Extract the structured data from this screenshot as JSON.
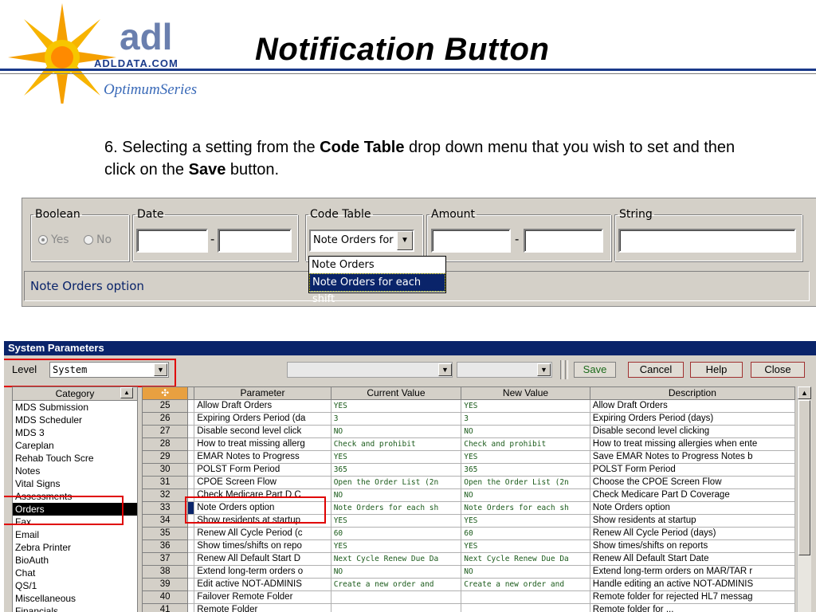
{
  "header": {
    "logo_text": "adl",
    "logo_domain": "ADLDATA.COM",
    "logo_series": "OptimumSeries",
    "title": "Notification Button",
    "accent_color": "#1a3a8a"
  },
  "instruction": {
    "prefix": "6. Selecting a setting from the ",
    "bold1": "Code Table",
    "middle": " drop down menu that you wish to set and then click on the ",
    "bold2": "Save",
    "suffix": "  button."
  },
  "settings_panel": {
    "boolean": {
      "legend": "Boolean",
      "yes_label": "Yes",
      "no_label": "No",
      "selected": "Yes"
    },
    "date": {
      "legend": "Date",
      "separator": "-"
    },
    "code_table": {
      "legend": "Code Table",
      "selected_value": "Note Orders for each shift",
      "options": [
        "Note Orders",
        "Note Orders for each shift"
      ],
      "highlighted_option": "Note Orders for each shift"
    },
    "amount": {
      "legend": "Amount",
      "separator": "-"
    },
    "string": {
      "legend": "String"
    },
    "status_text": "Note Orders option"
  },
  "window": {
    "title": "System Parameters",
    "level_label": "Level",
    "level_value": "System",
    "buttons": {
      "save": "Save",
      "cancel": "Cancel",
      "help": "Help",
      "close": "Close"
    },
    "category_header": "Category",
    "categories": [
      "MDS Submission",
      "MDS Scheduler",
      "MDS 3",
      "Careplan",
      "Rehab Touch Scre",
      "Notes",
      "Vital Signs",
      "Assessments",
      "Orders",
      "Fax",
      "Email",
      "Zebra Printer",
      "BioAuth",
      "Chat",
      "QS/1",
      "Miscellaneous",
      "Financials"
    ],
    "selected_category": "Orders",
    "grid": {
      "columns": [
        "Parameter",
        "Current Value",
        "New Value",
        "Description"
      ],
      "rows": [
        {
          "num": "25",
          "param": "Allow Draft Orders",
          "cur": "YES",
          "new": "YES",
          "desc": "Allow Draft Orders"
        },
        {
          "num": "26",
          "param": "Expiring Orders Period (da",
          "cur": "3",
          "new": "3",
          "desc": "Expiring Orders Period (days)"
        },
        {
          "num": "27",
          "param": "Disable second level click",
          "cur": "NO",
          "new": "NO",
          "desc": "Disable second level clicking"
        },
        {
          "num": "28",
          "param": "How to treat missing allerg",
          "cur": "Check and prohibit",
          "new": "Check and prohibit",
          "desc": "How to treat missing allergies when ente"
        },
        {
          "num": "29",
          "param": "EMAR Notes to Progress",
          "cur": "YES",
          "new": "YES",
          "desc": "Save EMAR Notes to Progress Notes b"
        },
        {
          "num": "30",
          "param": "POLST Form Period",
          "cur": "365",
          "new": "365",
          "desc": "POLST Form Period"
        },
        {
          "num": "31",
          "param": "CPOE Screen Flow",
          "cur": "Open the Order List (2n",
          "new": "Open the Order List (2n",
          "desc": "Choose the CPOE Screen Flow"
        },
        {
          "num": "32",
          "param": "Check Medicare Part D C",
          "cur": "NO",
          "new": "NO",
          "desc": "Check Medicare Part D Coverage"
        },
        {
          "num": "33",
          "param": "Note Orders option",
          "cur": "Note Orders for each sh",
          "new": "Note Orders for each sh",
          "desc": "Note Orders option"
        },
        {
          "num": "34",
          "param": "Show residents at startup",
          "cur": "YES",
          "new": "YES",
          "desc": "Show residents at startup"
        },
        {
          "num": "35",
          "param": "Renew All Cycle Period (c",
          "cur": "60",
          "new": "60",
          "desc": "Renew All Cycle Period (days)"
        },
        {
          "num": "36",
          "param": "Show times/shifts on repo",
          "cur": "YES",
          "new": "YES",
          "desc": "Show times/shifts on reports"
        },
        {
          "num": "37",
          "param": "Renew All Default Start D",
          "cur": "Next Cycle Renew Due Da",
          "new": "Next Cycle Renew Due Da",
          "desc": "Renew All Default Start Date"
        },
        {
          "num": "38",
          "param": "Extend long-term orders o",
          "cur": "NO",
          "new": "NO",
          "desc": "Extend long-term orders on MAR/TAR r"
        },
        {
          "num": "39",
          "param": "Edit active NOT-ADMINIS",
          "cur": "Create a new order and",
          "new": "Create a new order and",
          "desc": "Handle editing an active NOT-ADMINIS"
        },
        {
          "num": "40",
          "param": "Failover Remote Folder",
          "cur": "",
          "new": "",
          "desc": "Remote folder for rejected HL7 messag"
        },
        {
          "num": "41",
          "param": "Remote Folder",
          "cur": "",
          "new": "",
          "desc": "Remote folder for ..."
        }
      ]
    }
  }
}
